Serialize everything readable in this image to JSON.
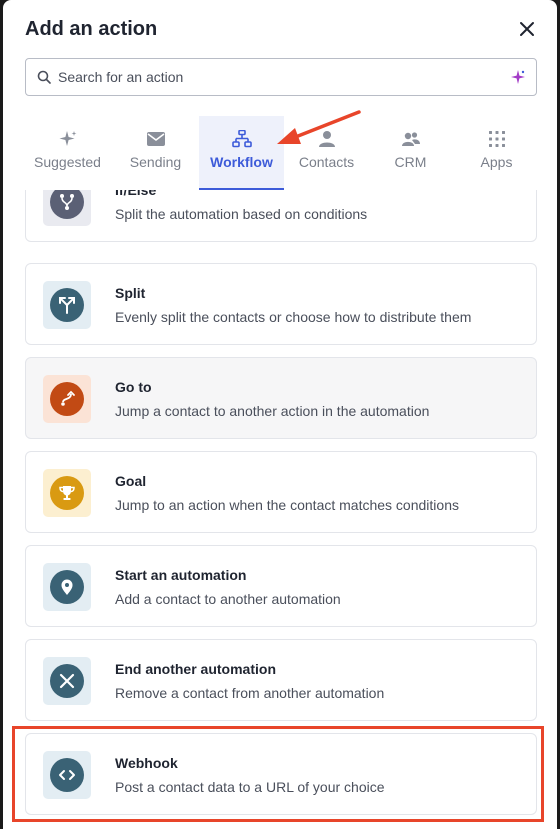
{
  "modal": {
    "title": "Add an action",
    "search": {
      "placeholder": "Search for an action",
      "value": ""
    }
  },
  "tabs": [
    {
      "label": "Suggested",
      "icon": "sparkle-icon",
      "active": false
    },
    {
      "label": "Sending",
      "icon": "envelope-icon",
      "active": false
    },
    {
      "label": "Workflow",
      "icon": "workflow-icon",
      "active": true
    },
    {
      "label": "Contacts",
      "icon": "person-icon",
      "active": false
    },
    {
      "label": "CRM",
      "icon": "people-icon",
      "active": false
    },
    {
      "label": "Apps",
      "icon": "grid-icon",
      "active": false
    }
  ],
  "actions": [
    {
      "title": "If/Else",
      "description": "Split the automation based on conditions",
      "icon": "branch-icon",
      "color": "#5b6075",
      "bg": "#e9eaf0"
    },
    {
      "title": "Split",
      "description": "Evenly split the contacts or choose how to distribute them",
      "icon": "split-icon",
      "color": "#3a6275",
      "bg": "#e3edf3"
    },
    {
      "title": "Go to",
      "description": "Jump a contact to another action in the automation",
      "icon": "goto-icon",
      "color": "#c24a14",
      "bg": "#fbe3d6"
    },
    {
      "title": "Goal",
      "description": "Jump to an action when the contact matches conditions",
      "icon": "trophy-icon",
      "color": "#d99a12",
      "bg": "#fcefd0"
    },
    {
      "title": "Start an automation",
      "description": "Add a contact to another automation",
      "icon": "location-pin-icon",
      "color": "#3a6275",
      "bg": "#e3edf3"
    },
    {
      "title": "End another automation",
      "description": "Remove a contact from another automation",
      "icon": "x-icon",
      "color": "#3a6275",
      "bg": "#e3edf3"
    },
    {
      "title": "Webhook",
      "description": "Post a contact data to a URL of your choice",
      "icon": "code-icon",
      "color": "#3a6275",
      "bg": "#e3edf3"
    }
  ],
  "colors": {
    "accent": "#3d5bd9",
    "annotation": "#e8452a"
  }
}
